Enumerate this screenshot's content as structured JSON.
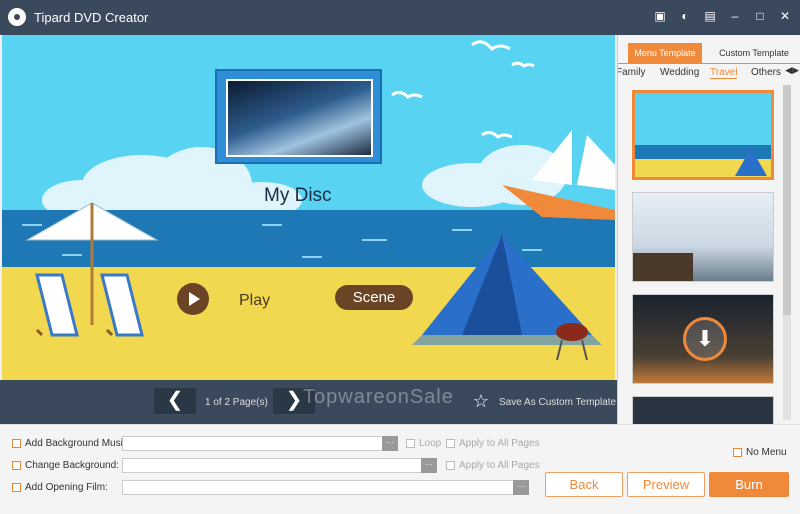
{
  "app": {
    "title": "Tipard DVD Creator"
  },
  "titlebar_icons": [
    "save-icon",
    "chat-icon",
    "feedback-icon",
    "minimize-icon",
    "maximize-icon",
    "close-icon"
  ],
  "preview": {
    "disc_title": "My Disc",
    "play_label": "Play",
    "scene_label": "Scene"
  },
  "nav": {
    "prev_label": "❮",
    "next_label": "❯",
    "page_count": "1 of 2 Page(s)",
    "watermark": "TopwareonSale",
    "save_custom": "Save As Custom Template"
  },
  "templates": {
    "tabs": {
      "menu": "Menu Template",
      "custom": "Custom Template"
    },
    "categories": [
      "Family",
      "Wedding",
      "Travel",
      "Others"
    ],
    "active_category": "Travel",
    "arrows": "◀▶"
  },
  "options": {
    "bg_music": "Add Background Music:",
    "change_bg": "Change Background:",
    "opening_film": "Add Opening Film:",
    "loop": "Loop",
    "apply_all_1": "Apply to All Pages",
    "apply_all_2": "Apply to All Pages",
    "dots": "···",
    "no_menu": "No Menu"
  },
  "buttons": {
    "back": "Back",
    "preview": "Preview",
    "burn": "Burn"
  },
  "colors": {
    "accent": "#f08a3a",
    "titlebar": "#3a4a5c",
    "sky": "#58d3f2",
    "sea": "#1e78b5",
    "sand": "#f2d84f"
  }
}
